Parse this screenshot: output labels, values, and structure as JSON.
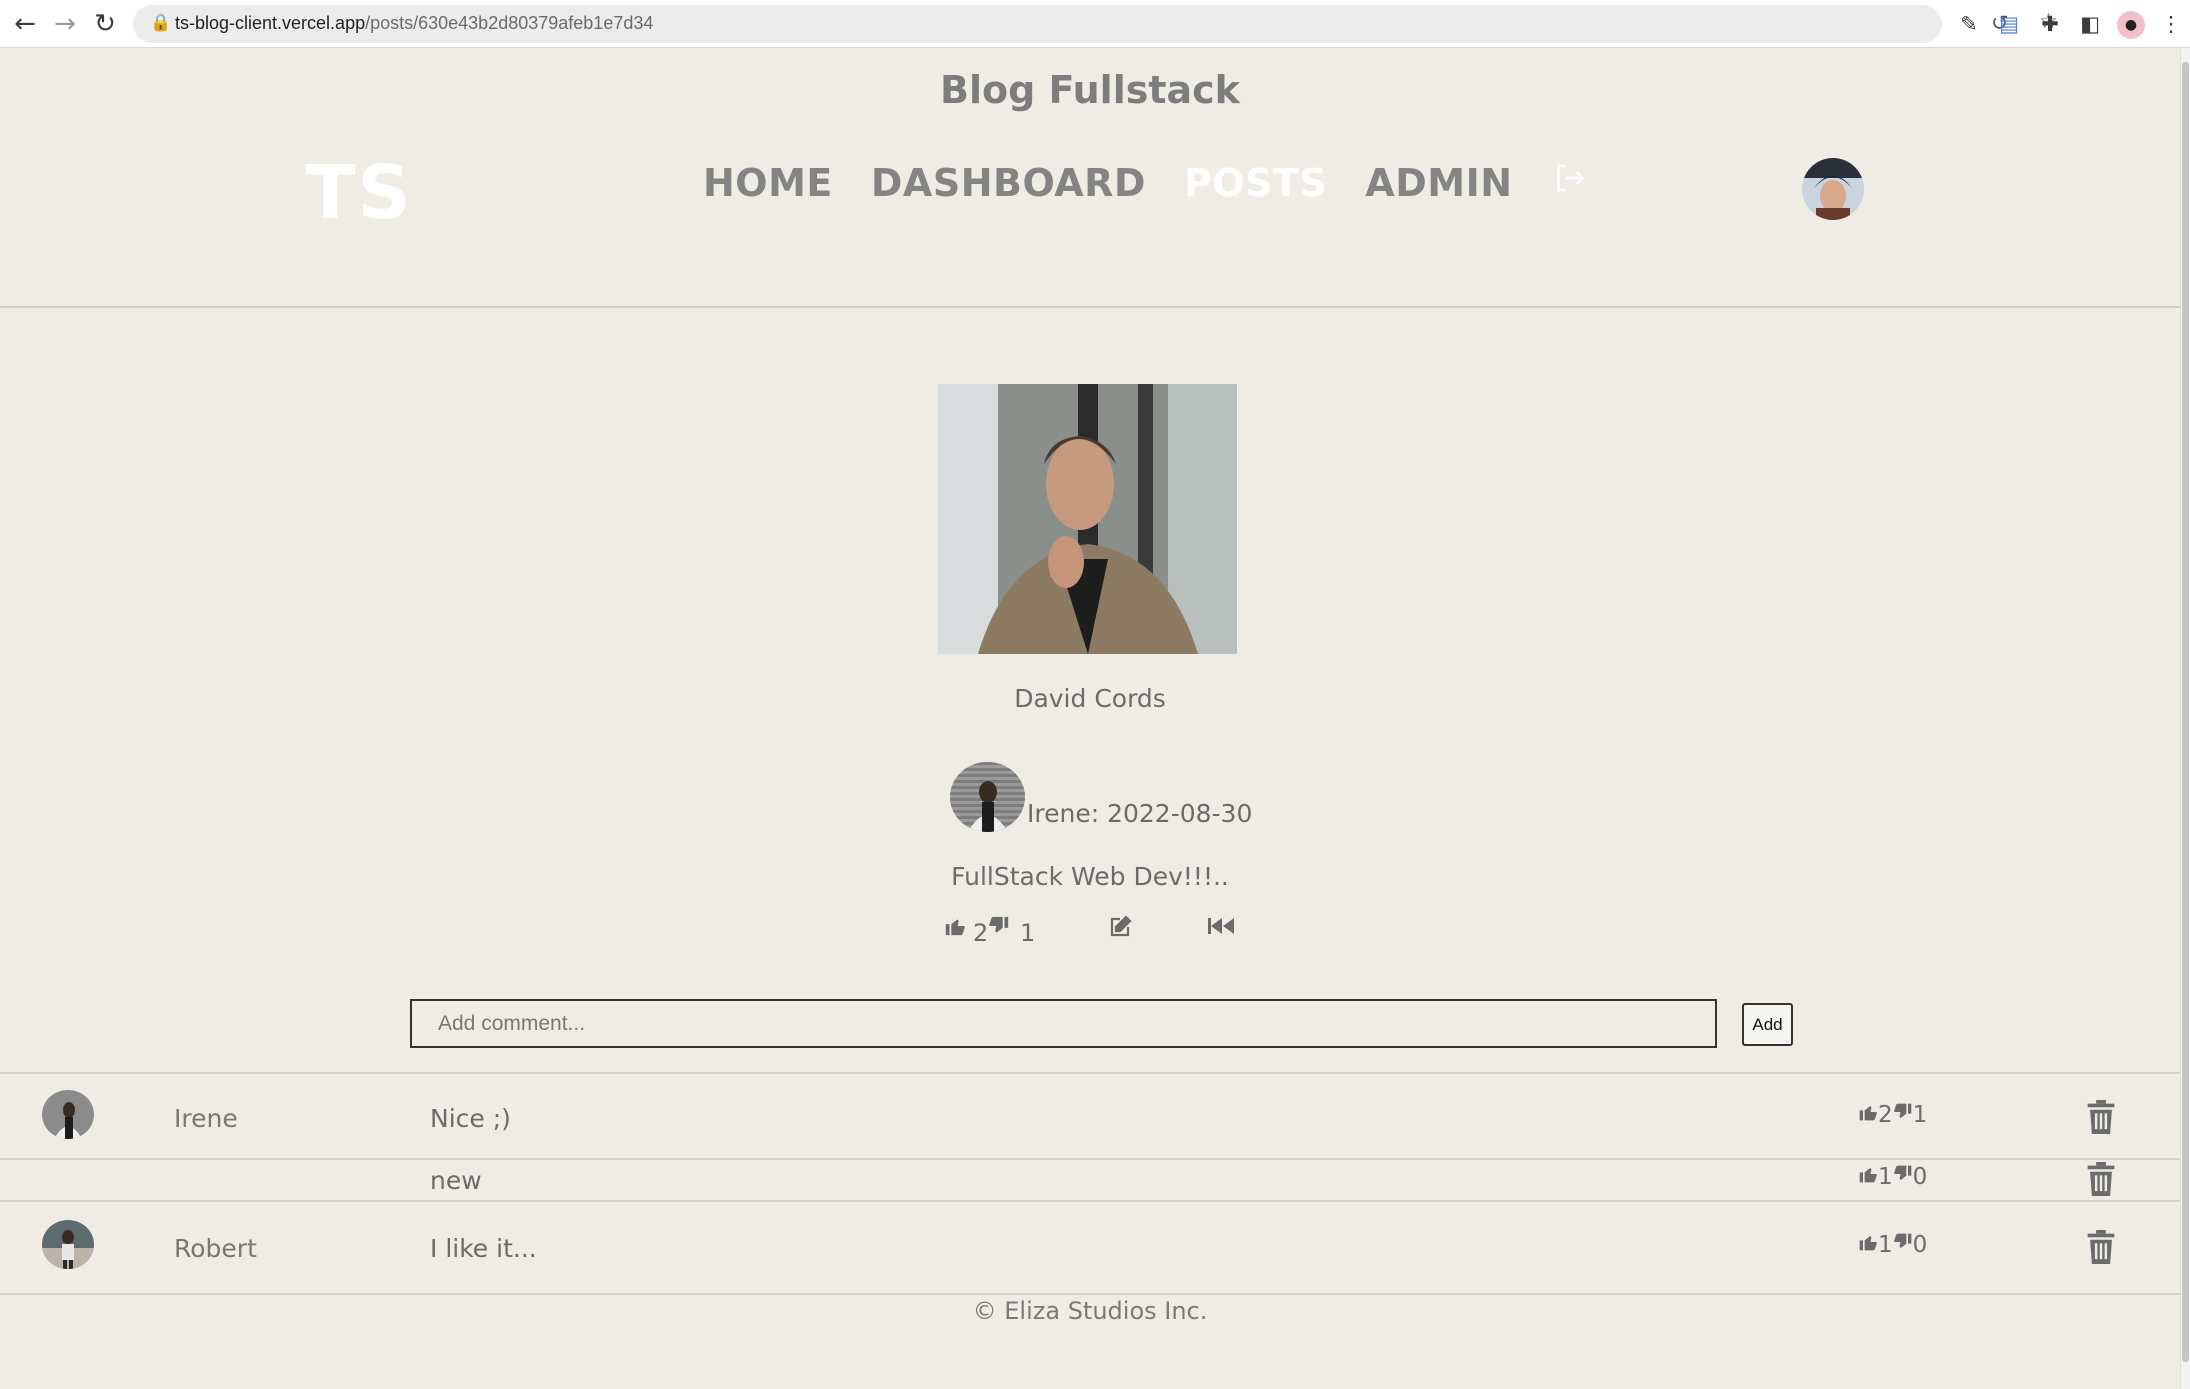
{
  "browser": {
    "url_host": "ts-blog-client.vercel.app",
    "url_path": "/posts/630e43b2d80379afeb1e7d34"
  },
  "header": {
    "site_title": "Blog Fullstack",
    "logo": "TS",
    "nav": [
      "HOME",
      "DASHBOARD",
      "POSTS",
      "ADMIN"
    ],
    "active_nav": "POSTS"
  },
  "post": {
    "title": "David Cords",
    "author_meta": "Irene: 2022-08-30",
    "description": "FullStack Web Dev!!!..",
    "likes": "2",
    "dislikes": "1"
  },
  "comment_form": {
    "placeholder": "Add comment...",
    "add_label": "Add"
  },
  "comments": [
    {
      "user": "Irene",
      "text": "Nice ;)",
      "likes": "2",
      "dislikes": "1"
    },
    {
      "user": "",
      "text": "new",
      "likes": "1",
      "dislikes": "0"
    },
    {
      "user": "Robert",
      "text": "I like it...",
      "likes": "1",
      "dislikes": "0"
    }
  ],
  "footer": "© Eliza Studios Inc.",
  "colors": {
    "background": "#efece6",
    "active_nav": "#ffffff",
    "muted_text": "#6e6e6e"
  }
}
